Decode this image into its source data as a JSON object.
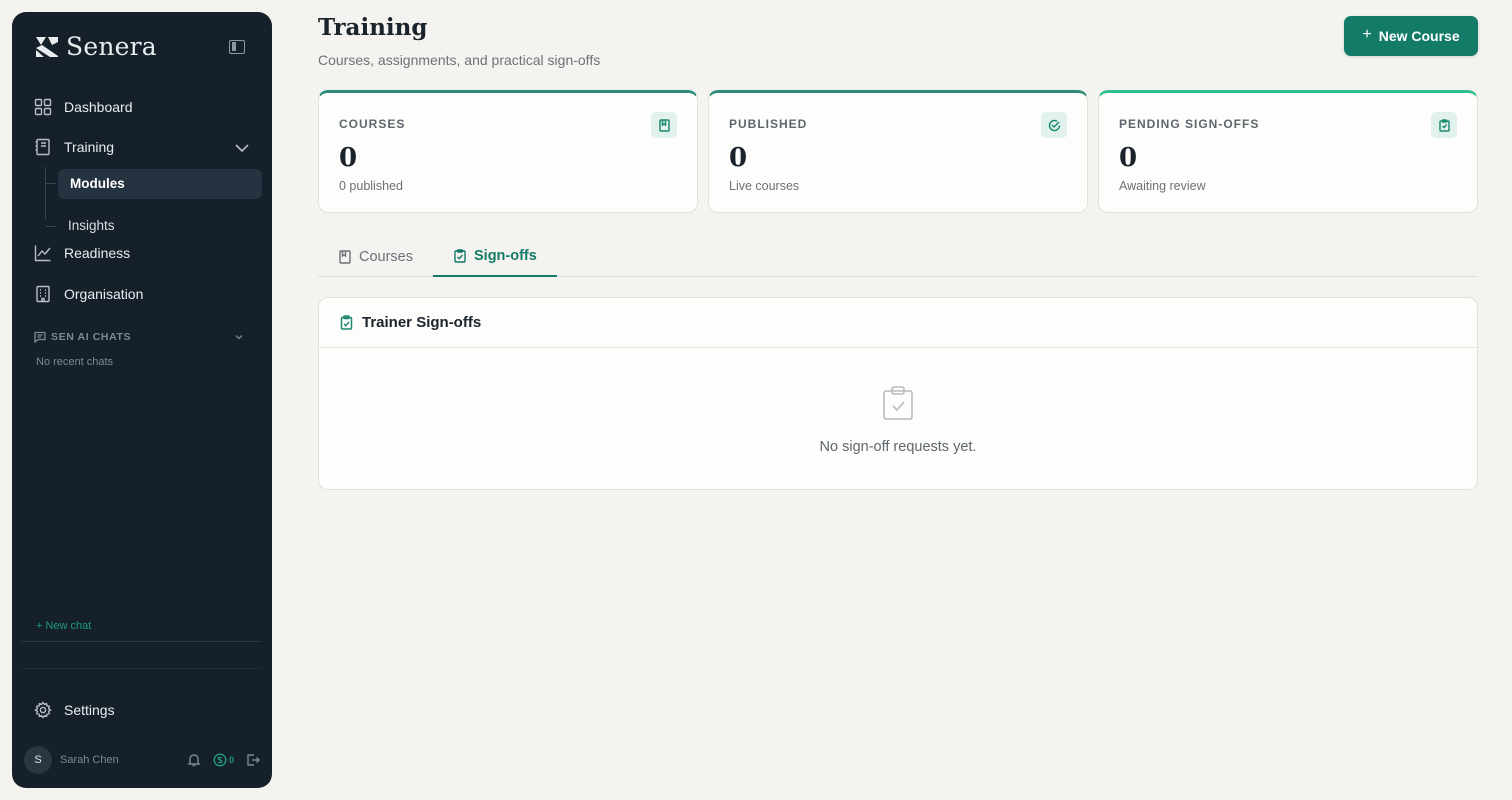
{
  "app": {
    "brand": "Senera"
  },
  "sidebar": {
    "nav": [
      {
        "label": "Dashboard",
        "icon": "grid-icon"
      },
      {
        "label": "Training",
        "icon": "book-icon"
      },
      {
        "label": "Readiness",
        "icon": "trend-chart-icon"
      },
      {
        "label": "Organisation",
        "icon": "building-icon"
      }
    ],
    "training_children": [
      {
        "label": "Modules",
        "active": true
      },
      {
        "label": "Insights",
        "active": false
      }
    ],
    "chats": {
      "title": "SEN AI CHATS",
      "empty": "No recent chats",
      "new_chat": "+ New chat"
    },
    "settings_label": "Settings",
    "user": {
      "initial": "S",
      "name": "Sarah Chen",
      "credits": "0"
    }
  },
  "header": {
    "title": "Training",
    "subtitle": "Courses, assignments, and practical sign-offs",
    "new_course_label": "New Course"
  },
  "stats": [
    {
      "label": "COURSES",
      "value": "0",
      "caption": "0 published",
      "icon": "book-icon"
    },
    {
      "label": "PUBLISHED",
      "value": "0",
      "caption": "Live courses",
      "icon": "check-circle-icon"
    },
    {
      "label": "PENDING SIGN-OFFS",
      "value": "0",
      "caption": "Awaiting review",
      "icon": "clipboard-icon"
    }
  ],
  "tabs": [
    {
      "label": "Courses",
      "active": false
    },
    {
      "label": "Sign-offs",
      "active": true
    }
  ],
  "panel": {
    "title": "Trainer Sign-offs",
    "empty_text": "No sign-off requests yet."
  },
  "colors": {
    "accent": "#137b68",
    "sidebar": "#16202a",
    "background": "#f4f3f0"
  }
}
